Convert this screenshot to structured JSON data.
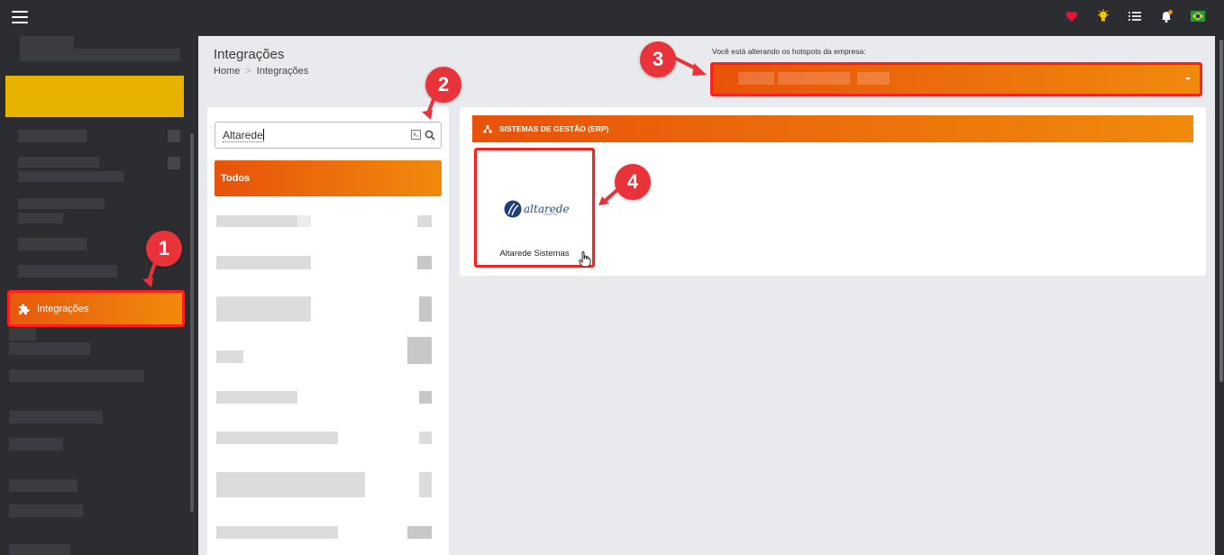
{
  "topbar": {
    "icons": [
      "heart-icon",
      "lightbulb-icon",
      "list-icon",
      "bell-icon",
      "brazil-flag-icon"
    ]
  },
  "sidebar": {
    "active_item": {
      "label": "Integrações",
      "icon": "puzzle-icon"
    }
  },
  "header": {
    "title": "Integrações",
    "breadcrumb": [
      "Home",
      "Integrações"
    ],
    "breadcrumb_separator": ">"
  },
  "company": {
    "label": "Você está alterando os hotspots da empresa:"
  },
  "search": {
    "value": "Altarede"
  },
  "filters": {
    "active": "Todos"
  },
  "category": {
    "title": "SISTEMAS DE GESTÃO (ERP)",
    "icon": "sitemap-icon"
  },
  "integrations": [
    {
      "name": "Altarede Sistemas",
      "logo_text": "altarede",
      "logo_sub": "sistemas"
    }
  ],
  "annotations": [
    "1",
    "2",
    "3",
    "4"
  ],
  "colors": {
    "accent_start": "#e8520a",
    "accent_end": "#f08a0c",
    "highlight_border": "#ff1e1e",
    "badge": "#e8333a",
    "sidebar_bg": "#2b2d31"
  }
}
